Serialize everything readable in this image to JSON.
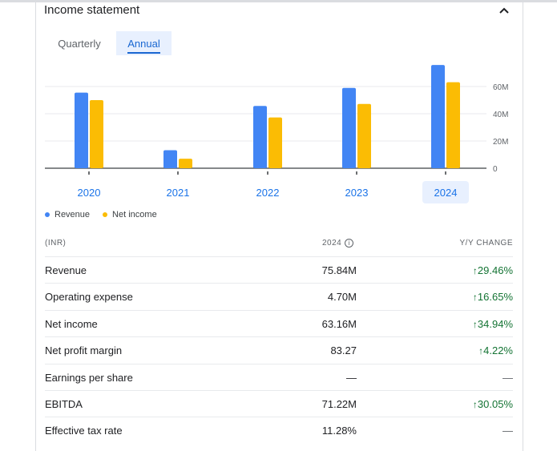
{
  "card": {
    "title": "Income statement",
    "tabs": [
      {
        "label": "Quarterly"
      },
      {
        "label": "Annual"
      }
    ],
    "selected_tab": "Annual"
  },
  "chart_data": {
    "type": "bar",
    "categories": [
      "2020",
      "2021",
      "2022",
      "2023",
      "2024"
    ],
    "series": [
      {
        "name": "Revenue",
        "color": "#4285f4",
        "values": [
          55.5,
          13.2,
          45.7,
          59.0,
          75.84
        ]
      },
      {
        "name": "Net income",
        "color": "#fbbc04",
        "values": [
          50.0,
          7.0,
          37.3,
          47.2,
          63.16
        ]
      }
    ],
    "y_ticks": [
      "0",
      "20M",
      "40M",
      "60M"
    ],
    "ylim": [
      0,
      80
    ],
    "selected_category": "2024",
    "grid": true,
    "legend_position": "bottom-left"
  },
  "legend": {
    "revenue": "Revenue",
    "net_income": "Net income"
  },
  "table": {
    "header": {
      "col1": "(INR)",
      "col2": "2024",
      "col3": "Y/Y CHANGE"
    },
    "rows": [
      {
        "label": "Revenue",
        "value": "75.84M",
        "change": "29.46%",
        "arrow": "↑"
      },
      {
        "label": "Operating expense",
        "value": "4.70M",
        "change": "16.65%",
        "arrow": "↑"
      },
      {
        "label": "Net income",
        "value": "63.16M",
        "change": "34.94%",
        "arrow": "↑"
      },
      {
        "label": "Net profit margin",
        "value": "83.27",
        "change": "4.22%",
        "arrow": "↑"
      },
      {
        "label": "Earnings per share",
        "value": "—",
        "change": "—",
        "arrow": ""
      },
      {
        "label": "EBITDA",
        "value": "71.22M",
        "change": "30.05%",
        "arrow": "↑"
      },
      {
        "label": "Effective tax rate",
        "value": "11.28%",
        "change": "—",
        "arrow": ""
      }
    ]
  }
}
